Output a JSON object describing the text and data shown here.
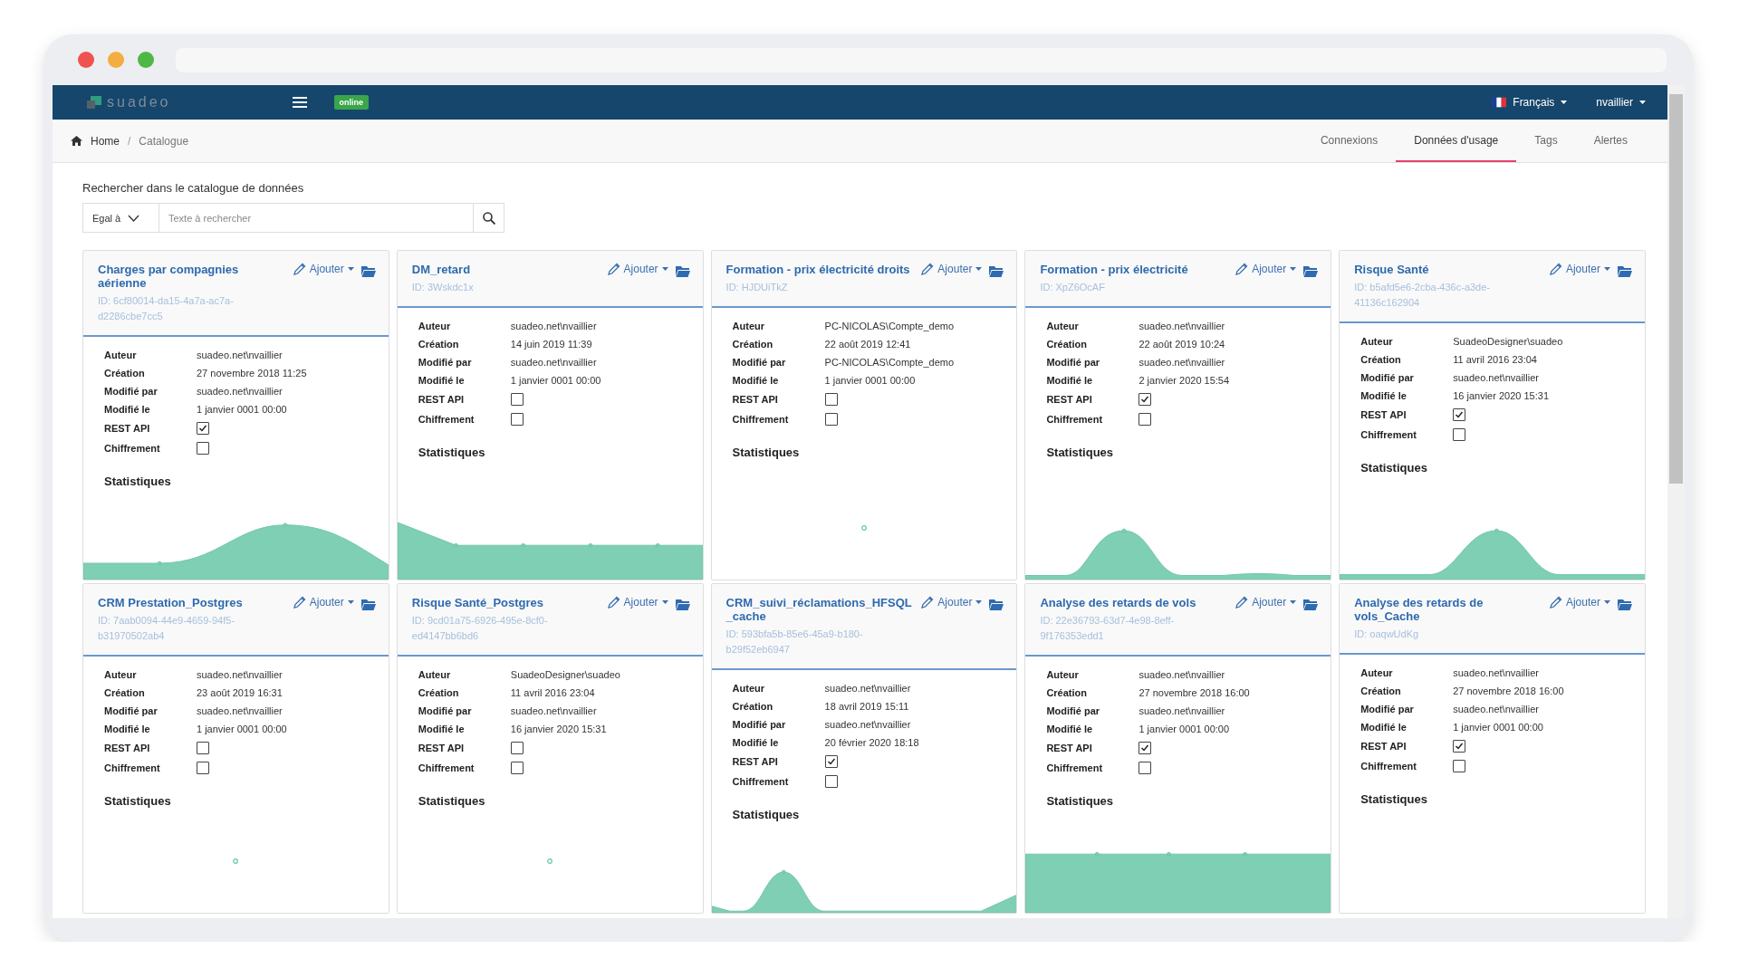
{
  "navbar": {
    "logo": "suadeo",
    "status_badge": "online",
    "language": "Français",
    "user": "nvaillier"
  },
  "breadcrumb": {
    "items": [
      "Home",
      "Catalogue"
    ],
    "separator": "/"
  },
  "tabs": [
    {
      "label": "Connexions",
      "selected": false
    },
    {
      "label": "Données d'usage",
      "selected": true
    },
    {
      "label": "Tags",
      "selected": false
    },
    {
      "label": "Alertes",
      "selected": false
    }
  ],
  "search": {
    "heading": "Rechercher dans le catalogue de données",
    "operator": "Egal à",
    "placeholder": "Texte à rechercher"
  },
  "cards": [
    {
      "title": "Charges par compagnies aérienne",
      "id": "ID: 6cf80014-da15-4a7a-ac7a-d2286cbe7cc5",
      "action": "Ajouter",
      "fields": [
        {
          "label": "Auteur",
          "value": "suadeo.net\\nvaillier"
        },
        {
          "label": "Création",
          "value": "27 novembre 2018 11:25"
        },
        {
          "label": "Modifié par",
          "value": "suadeo.net\\nvaillier"
        },
        {
          "label": "Modifié le",
          "value": "1 janvier 0001 00:00"
        }
      ],
      "flags": [
        {
          "label": "REST API",
          "checked": true
        },
        {
          "label": "Chiffrement",
          "checked": false
        }
      ],
      "stats": "Statistiques",
      "sparkline": {
        "kind": "hill"
      }
    },
    {
      "title": "DM_retard",
      "id": "ID: 3Wskdc1x",
      "action": "Ajouter",
      "fields": [
        {
          "label": "Auteur",
          "value": "suadeo.net\\nvaillier"
        },
        {
          "label": "Création",
          "value": "14 juin 2019 11:39"
        },
        {
          "label": "Modifié par",
          "value": "suadeo.net\\nvaillier"
        },
        {
          "label": "Modifié le",
          "value": "1 janvier 0001 00:00"
        }
      ],
      "flags": [
        {
          "label": "REST API",
          "checked": false
        },
        {
          "label": "Chiffrement",
          "checked": false
        }
      ],
      "stats": "Statistiques",
      "sparkline": {
        "kind": "decline"
      }
    },
    {
      "title": "Formation - prix électricité droits",
      "id": "ID: HJDUiTkZ",
      "action": "Ajouter",
      "fields": [
        {
          "label": "Auteur",
          "value": "PC-NICOLAS\\Compte_demo"
        },
        {
          "label": "Création",
          "value": "22 août 2019 12:41"
        },
        {
          "label": "Modifié par",
          "value": "PC-NICOLAS\\Compte_demo"
        },
        {
          "label": "Modifié le",
          "value": "1 janvier 0001 00:00"
        }
      ],
      "flags": [
        {
          "label": "REST API",
          "checked": false
        },
        {
          "label": "Chiffrement",
          "checked": false
        }
      ],
      "stats": "Statistiques",
      "sparkline": {
        "kind": "dot"
      }
    },
    {
      "title": "Formation - prix électricité",
      "id": "ID: XpZ6OcAF",
      "action": "Ajouter",
      "fields": [
        {
          "label": "Auteur",
          "value": "suadeo.net\\nvaillier"
        },
        {
          "label": "Création",
          "value": "22 août 2019 10:24"
        },
        {
          "label": "Modifié par",
          "value": "suadeo.net\\nvaillier"
        },
        {
          "label": "Modifié le",
          "value": "2 janvier 2020 15:54"
        }
      ],
      "flags": [
        {
          "label": "REST API",
          "checked": true
        },
        {
          "label": "Chiffrement",
          "checked": false
        }
      ],
      "stats": "Statistiques",
      "sparkline": {
        "kind": "peak-left"
      }
    },
    {
      "title": "Risque Santé",
      "id": "ID: b5afd5e6-2cba-436c-a3de-41136c162904",
      "action": "Ajouter",
      "fields": [
        {
          "label": "Auteur",
          "value": "SuadeoDesigner\\suadeo"
        },
        {
          "label": "Création",
          "value": "11 avril 2016 23:04"
        },
        {
          "label": "Modifié par",
          "value": "suadeo.net\\nvaillier"
        },
        {
          "label": "Modifié le",
          "value": "16 janvier 2020 15:31"
        }
      ],
      "flags": [
        {
          "label": "REST API",
          "checked": true
        },
        {
          "label": "Chiffrement",
          "checked": false
        }
      ],
      "stats": "Statistiques",
      "sparkline": {
        "kind": "peak-center"
      }
    },
    {
      "title": "CRM Prestation_Postgres",
      "id": "ID: 7aab0094-44e9-4659-94f5-b31970502ab4",
      "action": "Ajouter",
      "fields": [
        {
          "label": "Auteur",
          "value": "suadeo.net\\nvaillier"
        },
        {
          "label": "Création",
          "value": "23 août 2019 16:31"
        },
        {
          "label": "Modifié par",
          "value": "suadeo.net\\nvaillier"
        },
        {
          "label": "Modifié le",
          "value": "1 janvier 0001 00:00"
        }
      ],
      "flags": [
        {
          "label": "REST API",
          "checked": false
        },
        {
          "label": "Chiffrement",
          "checked": false
        }
      ],
      "stats": "Statistiques",
      "sparkline": {
        "kind": "dot"
      }
    },
    {
      "title": "Risque Santé_Postgres",
      "id": "ID: 9cd01a75-6926-495e-8cf0-ed4147bb6bd6",
      "action": "Ajouter",
      "fields": [
        {
          "label": "Auteur",
          "value": "SuadeoDesigner\\suadeo"
        },
        {
          "label": "Création",
          "value": "11 avril 2016 23:04"
        },
        {
          "label": "Modifié par",
          "value": "suadeo.net\\nvaillier"
        },
        {
          "label": "Modifié le",
          "value": "16 janvier 2020 15:31"
        }
      ],
      "flags": [
        {
          "label": "REST API",
          "checked": false
        },
        {
          "label": "Chiffrement",
          "checked": false
        }
      ],
      "stats": "Statistiques",
      "sparkline": {
        "kind": "dot"
      }
    },
    {
      "title": "CRM_suivi_réclamations_HFSQL_cache",
      "id": "ID: 593bfa5b-85e6-45a9-b180-b29f52eb6947",
      "action": "Ajouter",
      "fields": [
        {
          "label": "Auteur",
          "value": "suadeo.net\\nvaillier"
        },
        {
          "label": "Création",
          "value": "18 avril 2019 15:11"
        },
        {
          "label": "Modifié par",
          "value": "suadeo.net\\nvaillier"
        },
        {
          "label": "Modifié le",
          "value": "20 février 2020 18:18"
        }
      ],
      "flags": [
        {
          "label": "REST API",
          "checked": true
        },
        {
          "label": "Chiffrement",
          "checked": false
        }
      ],
      "stats": "Statistiques",
      "sparkline": {
        "kind": "twin"
      }
    },
    {
      "title": "Analyse des retards de vols",
      "id": "ID: 22e36793-63d7-4e98-8eff-9f176353edd1",
      "action": "Ajouter",
      "fields": [
        {
          "label": "Auteur",
          "value": "suadeo.net\\nvaillier"
        },
        {
          "label": "Création",
          "value": "27 novembre 2018 16:00"
        },
        {
          "label": "Modifié par",
          "value": "suadeo.net\\nvaillier"
        },
        {
          "label": "Modifié le",
          "value": "1 janvier 0001 00:00"
        }
      ],
      "flags": [
        {
          "label": "REST API",
          "checked": true
        },
        {
          "label": "Chiffrement",
          "checked": false
        }
      ],
      "stats": "Statistiques",
      "sparkline": {
        "kind": "block"
      }
    },
    {
      "title": "Analyse des retards de vols_Cache",
      "id": "ID: oaqwUdKg",
      "action": "Ajouter",
      "fields": [
        {
          "label": "Auteur",
          "value": "suadeo.net\\nvaillier"
        },
        {
          "label": "Création",
          "value": "27 novembre 2018 16:00"
        },
        {
          "label": "Modifié par",
          "value": "suadeo.net\\nvaillier"
        },
        {
          "label": "Modifié le",
          "value": "1 janvier 0001 00:00"
        }
      ],
      "flags": [
        {
          "label": "REST API",
          "checked": true
        },
        {
          "label": "Chiffrement",
          "checked": false
        }
      ],
      "stats": "Statistiques"
    }
  ]
}
